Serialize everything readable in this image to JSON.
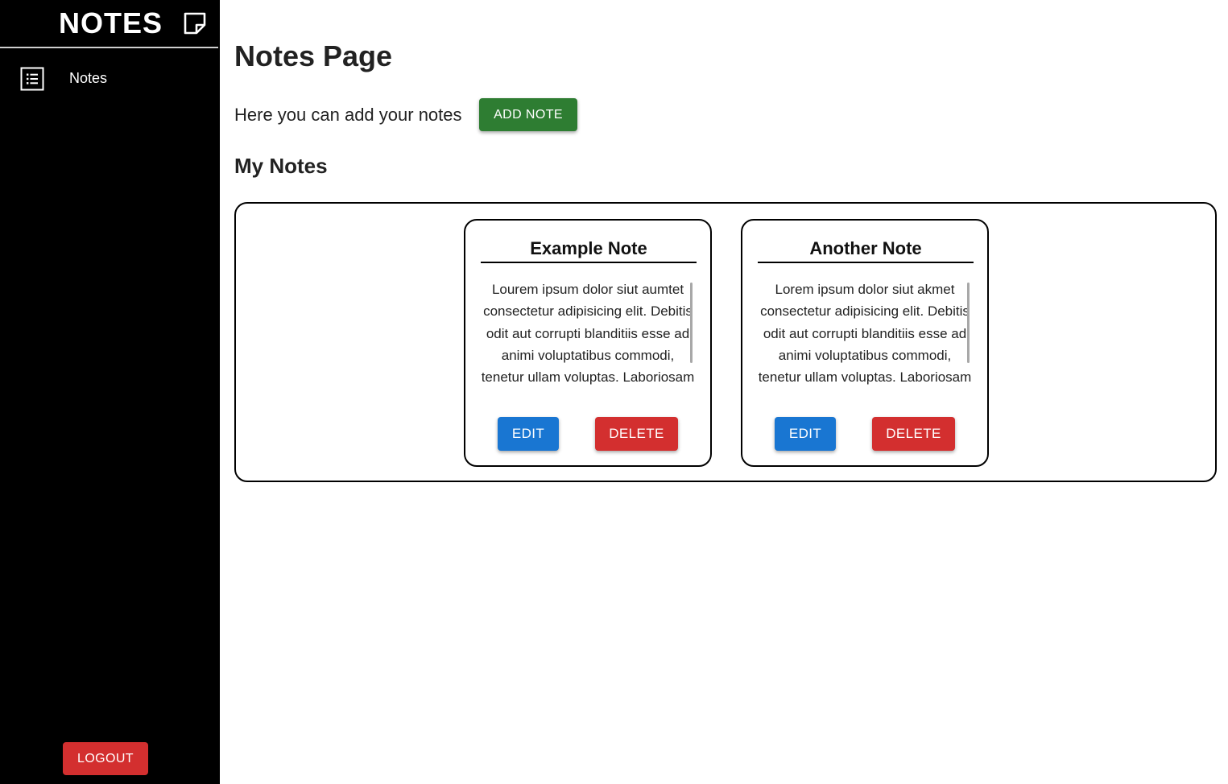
{
  "sidebar": {
    "brand_title": "NOTES",
    "brand_icon": "sticky-note-icon",
    "items": [
      {
        "label": "Notes",
        "icon": "list-icon"
      }
    ],
    "logout_label": "LOGOUT"
  },
  "main": {
    "title": "Notes Page",
    "intro_text": "Here you can add your notes",
    "add_note_label": "ADD NOTE",
    "section_title": "My Notes",
    "notes": [
      {
        "title": "Example Note",
        "body": "Lourem ipsum dolor siut aumtet consectetur adipisicing elit. Debitis odit aut corrupti blanditiis esse ad animi voluptatibus commodi, tenetur ullam voluptas. Laboriosam",
        "edit_label": "EDIT",
        "delete_label": "DELETE"
      },
      {
        "title": "Another Note",
        "body": "Lorem ipsum dolor siut akmet consectetur adipisicing elit. Debitis odit aut corrupti blanditiis esse ad animi voluptatibus commodi, tenetur ullam voluptas. Laboriosam",
        "edit_label": "EDIT",
        "delete_label": "DELETE"
      }
    ]
  },
  "colors": {
    "sidebar_bg": "#000000",
    "add_button": "#2e7d32",
    "edit_button": "#1976d2",
    "delete_button": "#d32f2f"
  }
}
